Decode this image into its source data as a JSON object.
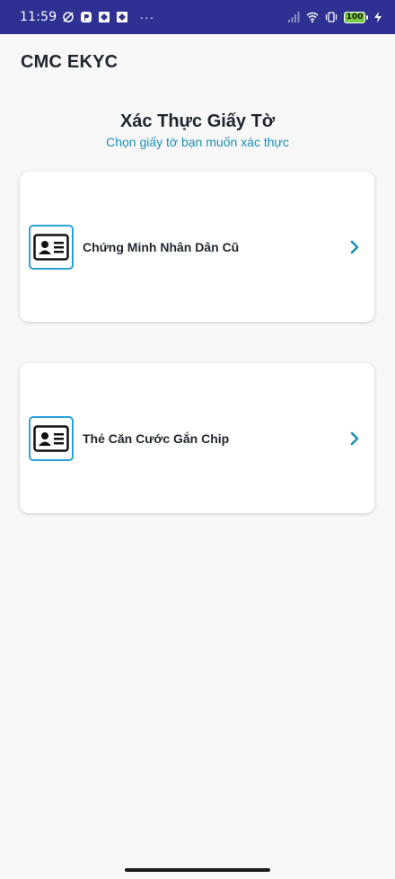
{
  "status_bar": {
    "time": "11:59",
    "dots": "···",
    "battery": "100"
  },
  "app": {
    "title": "CMC EKYC"
  },
  "page": {
    "heading": "Xác Thực Giấy Tờ",
    "subheading": "Chọn giấy tờ bạn muốn xác thực"
  },
  "options": [
    {
      "label": "Chứng Minh Nhân Dân Cũ",
      "icon": "id-card-icon"
    },
    {
      "label": "Thẻ Căn Cước Gắn Chip",
      "icon": "id-card-icon"
    }
  ],
  "colors": {
    "status_bar_bg": "#2e3192",
    "accent": "#1b8fb8",
    "icon_border": "#2a9fd8",
    "text_primary": "#1f2630",
    "background": "#f8f8f8"
  }
}
